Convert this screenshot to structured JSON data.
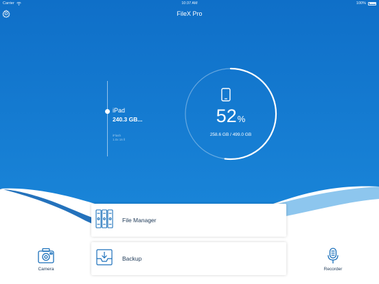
{
  "status_bar": {
    "carrier": "Carrier",
    "time": "10:37 AM",
    "battery": "100%"
  },
  "app": {
    "title": "FileX Pro"
  },
  "devices": [
    {
      "name": "iPad",
      "size": "240.3 GB..."
    },
    {
      "name": "iFlash",
      "size": "1.0x 16 ll"
    }
  ],
  "storage": {
    "used_percent": 52,
    "percent_unit": "%",
    "usage": "258.6 GB / 499.0 GB"
  },
  "actions": {
    "file_manager": "File Manager",
    "backup": "Backup",
    "camera": "Camera",
    "recorder": "Recorder"
  },
  "colors": {
    "primary": "#137ad3",
    "deep": "#0b5cae",
    "text": "#1f3a58"
  },
  "icons": {
    "settings": "gear-icon",
    "wifi": "wifi-icon",
    "battery": "battery-icon",
    "phone": "phone-icon",
    "file_manager": "folders-icon",
    "backup": "backup-icon",
    "camera": "camera-icon",
    "recorder": "microphone-icon"
  }
}
